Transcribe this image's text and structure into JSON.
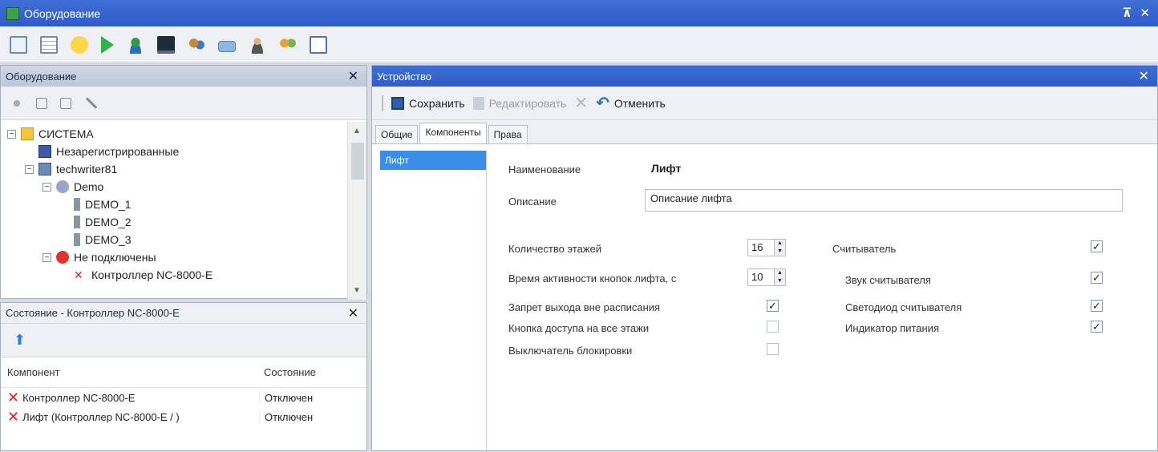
{
  "window": {
    "title": "Оборудование",
    "pin": "⊼",
    "close": "✕"
  },
  "left_top": {
    "title": "Оборудование",
    "close": "✕",
    "tree": [
      {
        "label": "СИСТЕМА",
        "level": 0,
        "expander": "−",
        "icon": "folder-icon"
      },
      {
        "label": "Незарегистрированные",
        "level": 1,
        "expander": "",
        "icon": "unregistered-icon"
      },
      {
        "label": "techwriter81",
        "level": 1,
        "expander": "−",
        "icon": "server-icon"
      },
      {
        "label": "Demo",
        "level": 2,
        "expander": "−",
        "icon": "demo-icon"
      },
      {
        "label": "DEMO_1",
        "level": 3,
        "expander": "",
        "icon": "device-icon"
      },
      {
        "label": "DEMO_2",
        "level": 3,
        "expander": "",
        "icon": "device-icon"
      },
      {
        "label": "DEMO_3",
        "level": 3,
        "expander": "",
        "icon": "device-icon"
      },
      {
        "label": "Не подключены",
        "level": 2,
        "expander": "−",
        "icon": "stop-icon"
      },
      {
        "label": "Контроллер NC-8000-E",
        "level": 3,
        "expander": "",
        "icon": "error-icon"
      }
    ]
  },
  "left_bottom": {
    "title": "Состояние - Контроллер NC-8000-E",
    "close": "✕",
    "columns": [
      "Компонент",
      "Состояние"
    ],
    "rows": [
      {
        "component": "Контроллер NC-8000-E",
        "state": "Отключен"
      },
      {
        "component": "Лифт (Контроллер NC-8000-E / )",
        "state": "Отключен"
      }
    ]
  },
  "device": {
    "title": "Устройство",
    "close": "✕",
    "actions": {
      "save": "Сохранить",
      "edit": "Редактировать",
      "cancel": "Отменить"
    },
    "tabs": [
      "Общие",
      "Компоненты",
      "Права"
    ],
    "active_tab": "Компоненты",
    "components": [
      "Лифт"
    ],
    "form": {
      "name_label": "Наименование",
      "name_value": "Лифт",
      "desc_label": "Описание",
      "desc_value": "Описание лифта",
      "floors_label": "Количество этажей",
      "floors_value": "16",
      "btn_time_label": "Время активности кнопок лифта, с",
      "btn_time_value": "10",
      "ban_exit_label": "Запрет выхода вне расписания",
      "ban_exit_checked": true,
      "all_floors_label": "Кнопка доступа на все этажи",
      "all_floors_checked": false,
      "block_switch_label": "Выключатель блокировки",
      "block_switch_checked": false,
      "reader_label": "Считыватель",
      "reader_checked": true,
      "reader_sound_label": "Звук считывателя",
      "reader_sound_checked": true,
      "reader_led_label": "Светодиод считывателя",
      "reader_led_checked": true,
      "power_ind_label": "Индикатор питания",
      "power_ind_checked": true
    }
  }
}
